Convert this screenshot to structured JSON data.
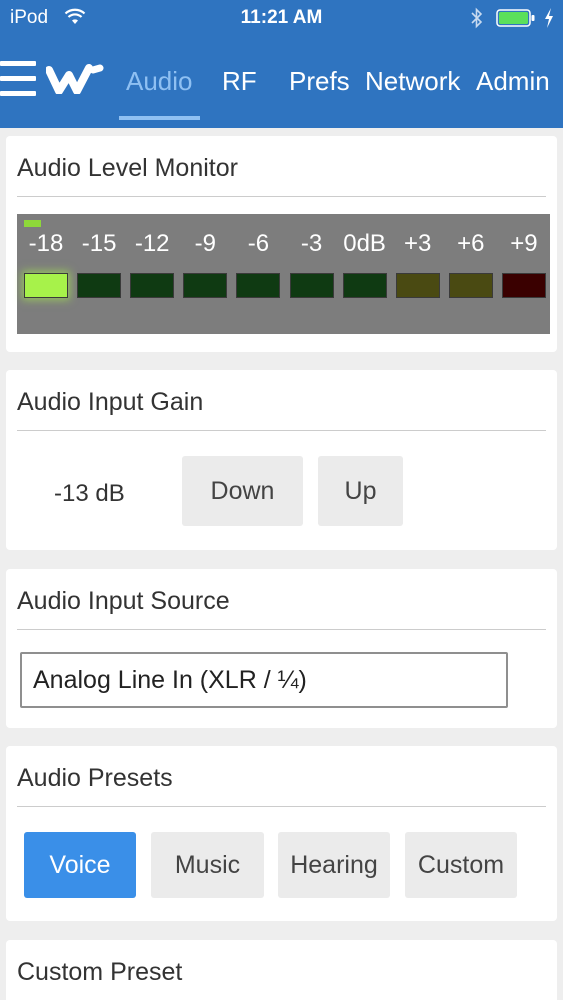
{
  "status_bar": {
    "carrier": "iPod",
    "time": "11:21 AM",
    "wifi_icon": "wifi-icon",
    "bluetooth_icon": "bluetooth-icon",
    "battery_icon": "battery-icon",
    "charging_icon": "charging-bolt-icon"
  },
  "nav": {
    "menu_icon": "hamburger-menu-icon",
    "logo_icon": "brand-logo-icon",
    "tabs": [
      {
        "label": "Audio",
        "active": true
      },
      {
        "label": "RF",
        "active": false
      },
      {
        "label": "Prefs",
        "active": false
      },
      {
        "label": "Network",
        "active": false
      },
      {
        "label": "Admin",
        "active": false
      }
    ]
  },
  "level_monitor": {
    "title": "Audio Level Monitor",
    "labels": [
      "-18",
      "-15",
      "-12",
      "-9",
      "-6",
      "-3",
      "0dB",
      "+3",
      "+6",
      "+9"
    ],
    "lit_segments": 1,
    "segment_colors_lit": [
      "#a7f24a"
    ],
    "segment_colors_unlit": [
      "#0f3a12",
      "#0f3a12",
      "#0f3a12",
      "#0f3a12",
      "#0f3a12",
      "#0f3a12",
      "#0f3a12",
      "#4a4a12",
      "#4a4a12",
      "#3a0000"
    ]
  },
  "input_gain": {
    "title": "Audio Input Gain",
    "value": "-13 dB",
    "down_label": "Down",
    "up_label": "Up"
  },
  "input_source": {
    "title": "Audio Input Source",
    "selected": "Analog Line In (XLR / ¼)"
  },
  "presets": {
    "title": "Audio Presets",
    "options": [
      {
        "label": "Voice",
        "active": true
      },
      {
        "label": "Music",
        "active": false
      },
      {
        "label": "Hearing",
        "active": false
      },
      {
        "label": "Custom",
        "active": false
      }
    ]
  },
  "custom_preset": {
    "title": "Custom Preset"
  },
  "colors": {
    "header_bg": "#2f74c0",
    "active_tab": "#8fc0f2",
    "active_button": "#3a8fe8",
    "page_bg": "#eeeeee"
  }
}
